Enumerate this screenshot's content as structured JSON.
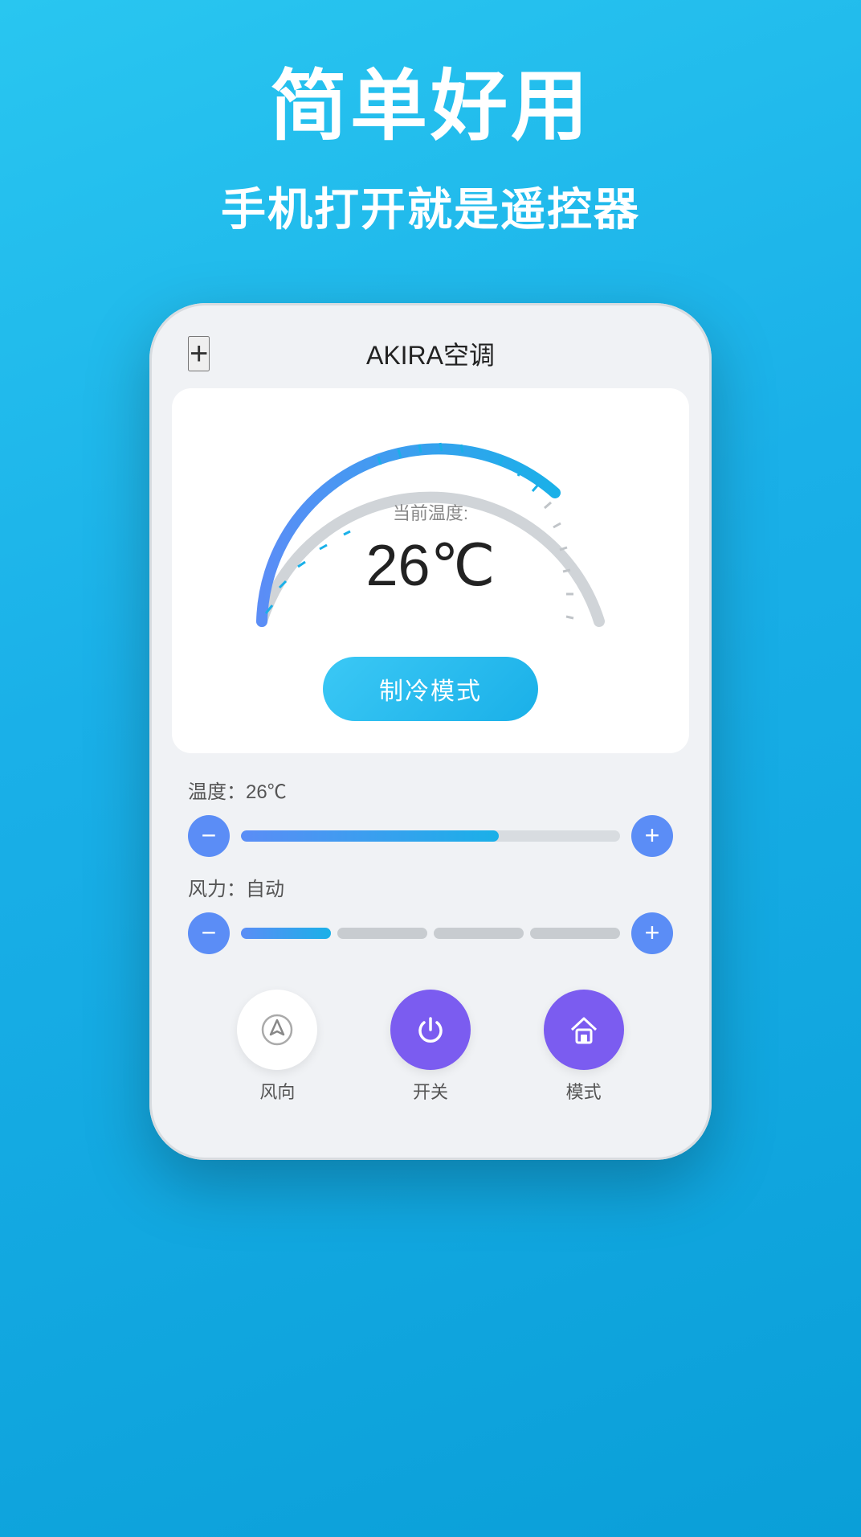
{
  "top": {
    "headline": "简单好用",
    "subheadline": "手机打开就是遥控器"
  },
  "phone": {
    "add_btn": "+",
    "title": "AKIRA空调",
    "dial": {
      "current_label": "当前温度:",
      "current_value": "26℃"
    },
    "mode_btn": "制冷模式",
    "temperature_control": {
      "label": "温度：26℃",
      "fill_percent": 68
    },
    "wind_control": {
      "label": "风力：自动",
      "segments": [
        {
          "active": true
        },
        {
          "active": false
        },
        {
          "active": false
        },
        {
          "active": false
        }
      ]
    },
    "bottom_buttons": [
      {
        "id": "wind-dir",
        "label": "风向",
        "icon": "wind",
        "color": "white"
      },
      {
        "id": "power",
        "label": "开关",
        "icon": "power",
        "color": "purple"
      },
      {
        "id": "mode",
        "label": "模式",
        "icon": "home",
        "color": "purple"
      }
    ]
  },
  "colors": {
    "brand_blue": "#1ab0e8",
    "purple": "#7b5cf0",
    "slider_blue": "#1ab0e8"
  }
}
